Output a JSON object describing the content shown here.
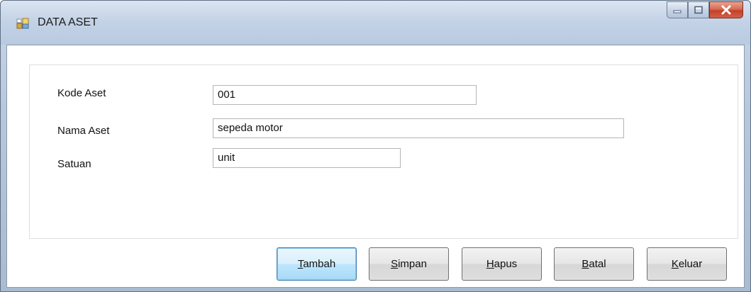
{
  "window": {
    "title": "DATA ASET",
    "title_icon": "form-icon",
    "controls": [
      "minimize-icon",
      "maximize-icon",
      "close-icon"
    ]
  },
  "form": {
    "kode": {
      "label": "Kode Aset",
      "value": "001"
    },
    "nama": {
      "label": "Nama Aset",
      "value": "sepeda motor"
    },
    "satuan": {
      "label": "Satuan",
      "value": "unit"
    }
  },
  "buttons": {
    "tambah": {
      "first": "T",
      "rest": "ambah"
    },
    "simpan": {
      "first": "S",
      "rest": "impan"
    },
    "hapus": {
      "first": "H",
      "rest": "apus"
    },
    "batal": {
      "first": "B",
      "rest": "atal"
    },
    "keluar": {
      "first": "K",
      "rest": "eluar"
    }
  },
  "colors": {
    "close_button": "#c4402a",
    "focus_border": "#3c7fb1"
  }
}
